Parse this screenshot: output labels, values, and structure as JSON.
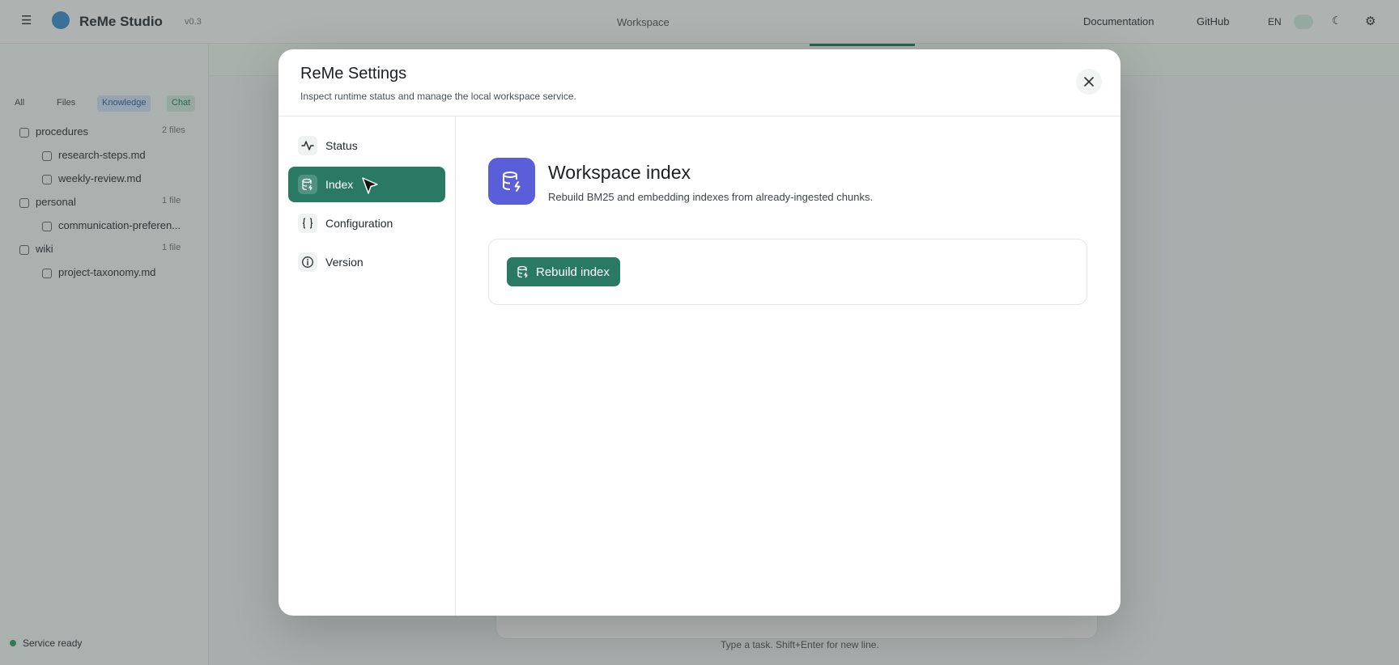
{
  "background": {
    "app_name": "ReMe Studio",
    "version": "v0.3",
    "workspace": "Workspace",
    "docs_link": "Documentation",
    "github_link": "GitHub",
    "lang": "EN",
    "chips": [
      "All",
      "Files",
      "Knowledge",
      "Chat"
    ],
    "tree": [
      {
        "label": "procedures",
        "count": "2 files",
        "type": "folder"
      },
      {
        "label": "research-steps.md",
        "type": "file"
      },
      {
        "label": "weekly-review.md",
        "type": "file"
      },
      {
        "label": "personal",
        "count": "1 file",
        "type": "folder"
      },
      {
        "label": "communication-preferen...",
        "type": "file"
      },
      {
        "label": "wiki",
        "count": "1 file",
        "type": "folder"
      },
      {
        "label": "project-taxonomy.md",
        "type": "file"
      }
    ],
    "status": "Service ready",
    "hint": "Type a task. Shift+Enter for new line."
  },
  "modal": {
    "title": "ReMe Settings",
    "subtitle": "Inspect runtime status and manage the local workspace service.",
    "close_icon": "close-icon"
  },
  "nav": {
    "items": [
      {
        "label": "Status",
        "icon": "activity-icon",
        "active": false
      },
      {
        "label": "Index",
        "icon": "database-icon",
        "active": true
      },
      {
        "label": "Configuration",
        "icon": "braces-icon",
        "active": false
      },
      {
        "label": "Version",
        "icon": "info-icon",
        "active": false
      }
    ]
  },
  "index_panel": {
    "title": "Workspace index",
    "description": "Rebuild BM25 and embedding indexes from already-ingested chunks.",
    "button_label": "Rebuild index",
    "icon_color": "#5a5fd9"
  },
  "colors": {
    "accent": "#2a7a63",
    "index_icon_bg": "#5a5fd9"
  }
}
